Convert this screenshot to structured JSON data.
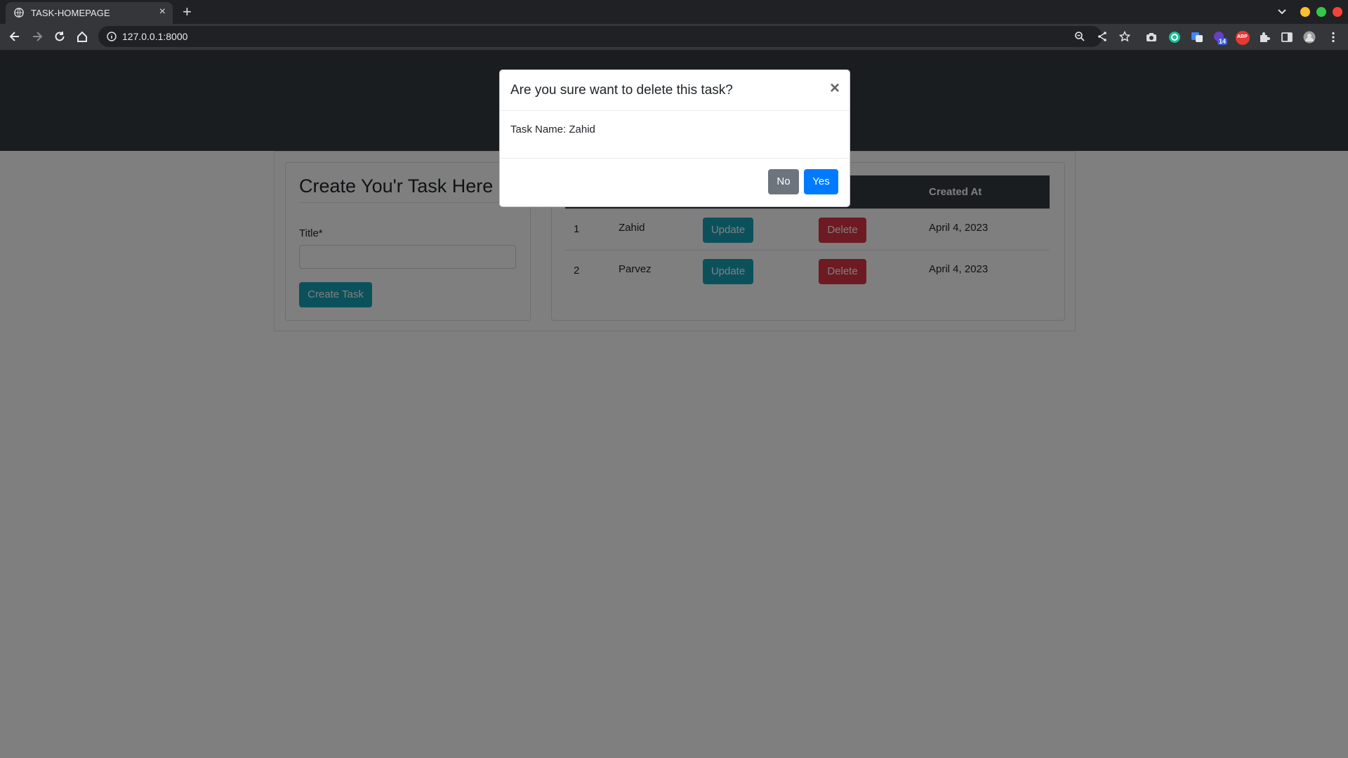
{
  "browser": {
    "tab_title": "TASK-HOMEPAGE",
    "tab_close": "×",
    "new_tab": "+",
    "url": "127.0.0.1:8000",
    "extension_badge": "14",
    "abp_label": "ABP"
  },
  "create_form": {
    "heading": "Create You'r Task Here",
    "title_label": "Title*",
    "title_value": "",
    "submit_label": "Create Task"
  },
  "task_table": {
    "header_created_at": "Created At",
    "rows": [
      {
        "index": "1",
        "name": "Zahid",
        "update_label": "Update",
        "delete_label": "Delete",
        "created_at": "April 4, 2023"
      },
      {
        "index": "2",
        "name": "Parvez",
        "update_label": "Update",
        "delete_label": "Delete",
        "created_at": "April 4, 2023"
      }
    ]
  },
  "modal": {
    "title": "Are you sure want to delete this task?",
    "close": "×",
    "body": "Task Name: Zahid",
    "no_label": "No",
    "yes_label": "Yes"
  },
  "colors": {
    "navbar": "#343a40",
    "info": "#17a2b8",
    "danger": "#dc3545",
    "primary": "#007bff",
    "secondary": "#6c757d"
  }
}
